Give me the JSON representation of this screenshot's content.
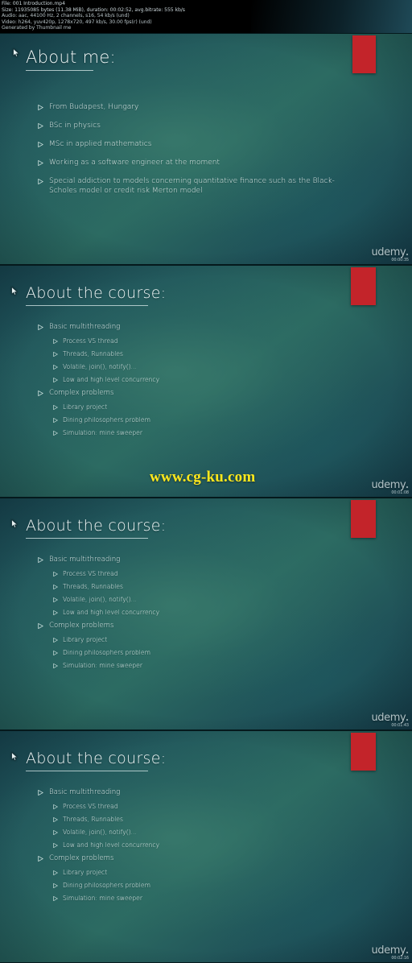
{
  "header": {
    "lines": [
      "File: 001 Introduction.mp4",
      "Size: 11935085 bytes (11.38 MiB), duration: 00:02:52, avg.bitrate: 555 kb/s",
      "Audio: aac, 44100 Hz, 2 channels, s16, 54 kb/s (und)",
      "Video: h264, yuv420p, 1278x720, 497 kb/s, 30.00 fps(r) (und)",
      "Generated by Thumbnail me"
    ]
  },
  "watermark": {
    "brand": "udemy",
    "site": "www.cg-ku.com",
    "site_color": "#ffe81c",
    "accent_color": "#c3242a"
  },
  "slides": [
    {
      "title": "About me",
      "title_colon": ":",
      "timestamp": "00:00:35",
      "bullets": [
        {
          "level": 1,
          "text": "From Budapest, Hungary"
        },
        {
          "level": 1,
          "text": "BSc in physics"
        },
        {
          "level": 1,
          "text": "MSc in applied mathematics"
        },
        {
          "level": 1,
          "text": "Working as a software engineer at the moment"
        },
        {
          "level": 1,
          "text": "Special addiction to models concerning quantitative finance such as the Black-Scholes model or credit risk Merton model"
        }
      ]
    },
    {
      "title": "About the course",
      "title_colon": ":",
      "timestamp": "00:01:08",
      "bullets": [
        {
          "level": 1,
          "text": "Basic multithreading"
        },
        {
          "level": 2,
          "text": "Process VS thread"
        },
        {
          "level": 2,
          "text": "Threads, Runnables"
        },
        {
          "level": 2,
          "text": "Volatile, join(), notify()..."
        },
        {
          "level": 2,
          "text": "Low and high level concurrency"
        },
        {
          "level": 1,
          "text": "Complex problems"
        },
        {
          "level": 2,
          "text": "Library project"
        },
        {
          "level": 2,
          "text": "Dining philosophers problem"
        },
        {
          "level": 2,
          "text": "Simulation: mine sweeper"
        }
      ]
    },
    {
      "title": "About the course",
      "title_colon": ":",
      "timestamp": "00:01:43",
      "bullets": [
        {
          "level": 1,
          "text": "Basic multithreading"
        },
        {
          "level": 2,
          "text": "Process VS thread"
        },
        {
          "level": 2,
          "text": "Threads, Runnables"
        },
        {
          "level": 2,
          "text": "Volatile, join(), notify()..."
        },
        {
          "level": 2,
          "text": "Low and high level concurrency"
        },
        {
          "level": 1,
          "text": "Complex problems"
        },
        {
          "level": 2,
          "text": "Library project"
        },
        {
          "level": 2,
          "text": "Dining philosophers problem"
        },
        {
          "level": 2,
          "text": "Simulation: mine sweeper"
        }
      ]
    },
    {
      "title": "About the course",
      "title_colon": ":",
      "timestamp": "00:02:16",
      "bullets": [
        {
          "level": 1,
          "text": "Basic multithreading"
        },
        {
          "level": 2,
          "text": "Process VS thread"
        },
        {
          "level": 2,
          "text": "Threads, Runnables"
        },
        {
          "level": 2,
          "text": "Volatile, join(), notify()..."
        },
        {
          "level": 2,
          "text": "Low and high level concurrency"
        },
        {
          "level": 1,
          "text": "Complex problems"
        },
        {
          "level": 2,
          "text": "Library project"
        },
        {
          "level": 2,
          "text": "Dining philosophers problem"
        },
        {
          "level": 2,
          "text": "Simulation: mine sweeper"
        }
      ]
    }
  ]
}
